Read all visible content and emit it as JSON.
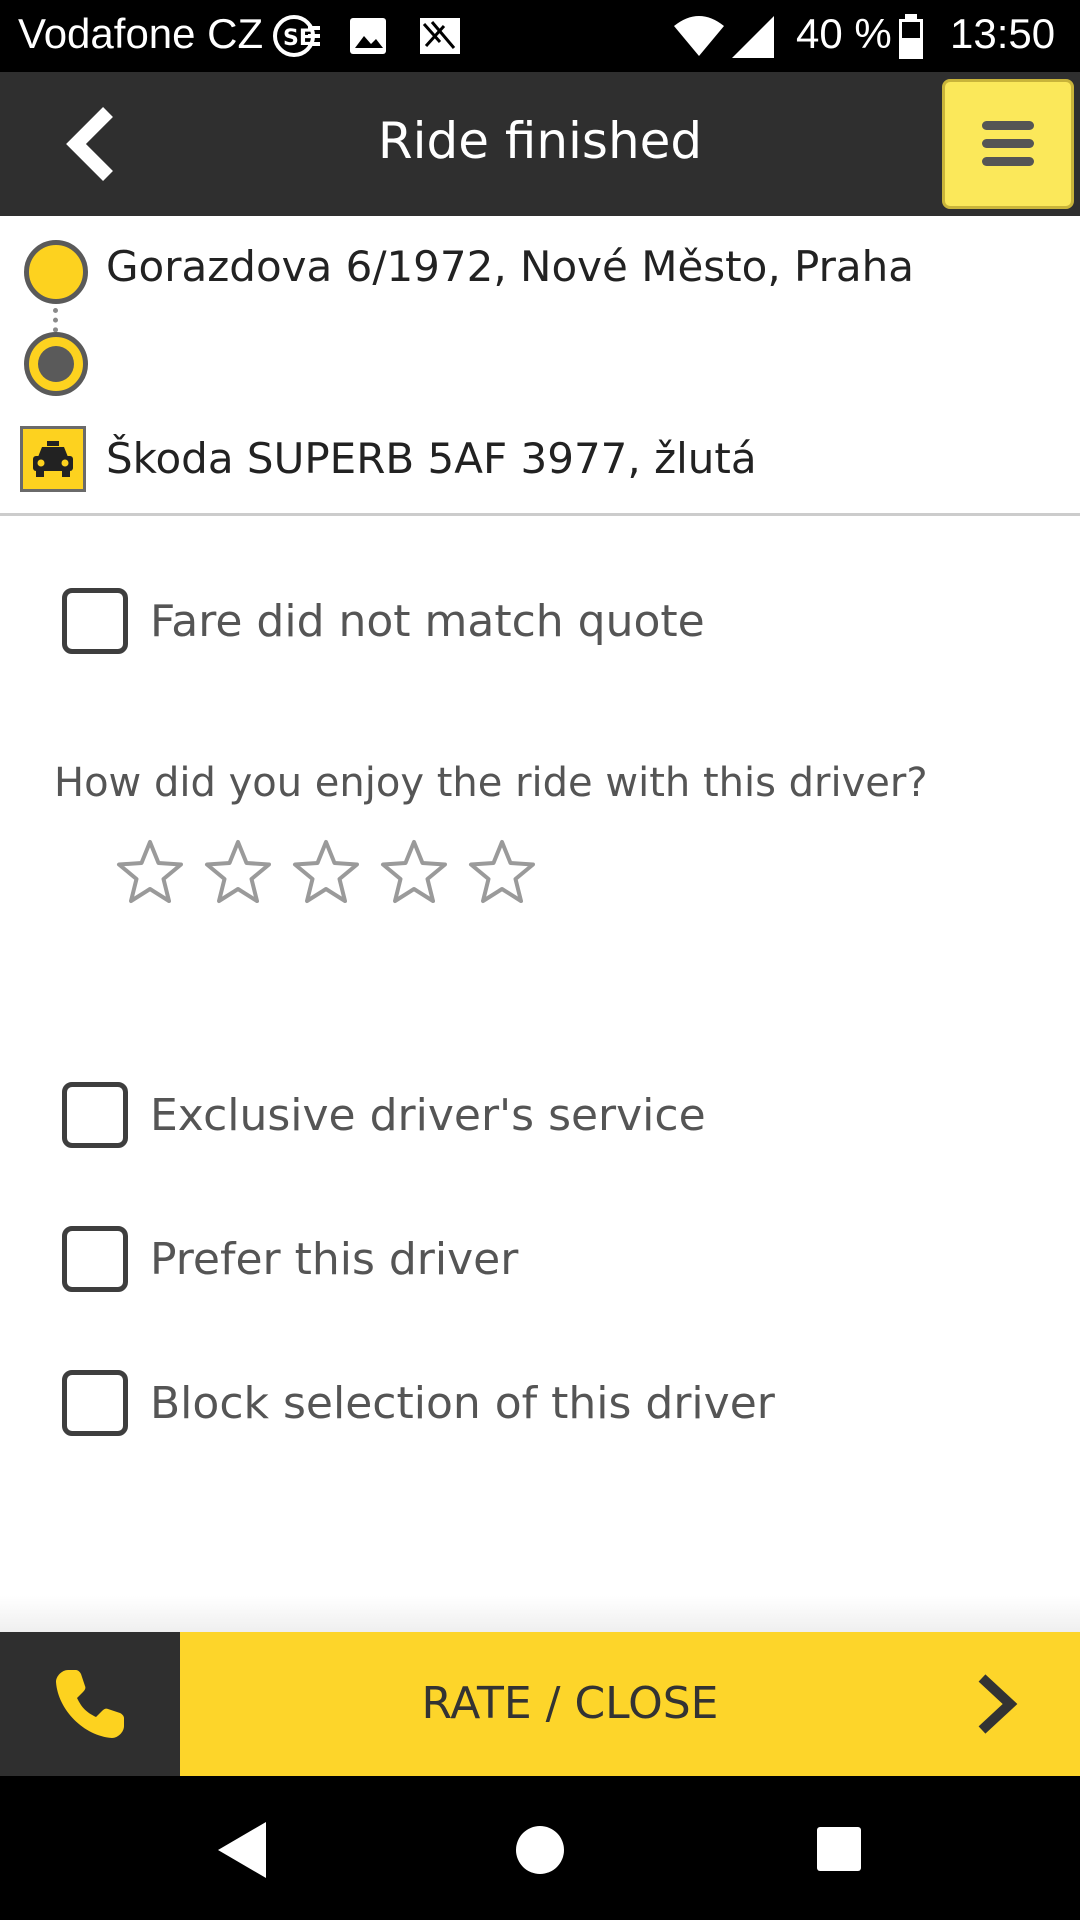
{
  "status_bar": {
    "carrier": "Vodafone CZ",
    "battery": "40 %",
    "time": "13:50"
  },
  "app_bar": {
    "title": "Ride finished"
  },
  "route": {
    "from_address": "Gorazdova 6/1972, Nové Město, Praha",
    "to_address": "",
    "car": "Škoda SUPERB 5AF 3977, žlutá"
  },
  "options": {
    "fare_mismatch": {
      "label": "Fare did not match quote",
      "checked": false
    },
    "exclusive_service": {
      "label": "Exclusive driver's service",
      "checked": false
    },
    "prefer_driver": {
      "label": "Prefer this driver",
      "checked": false
    },
    "block_driver": {
      "label": "Block selection of this driver",
      "checked": false
    }
  },
  "rating": {
    "question": "How did you enjoy the ride with this driver?",
    "max_stars": 5,
    "value": 0
  },
  "action_bar": {
    "primary_label": "RATE / CLOSE"
  },
  "colors": {
    "accent_yellow": "#fdd52a",
    "dark_bar": "#2f2f2f",
    "menu_button": "#fbe85a"
  }
}
